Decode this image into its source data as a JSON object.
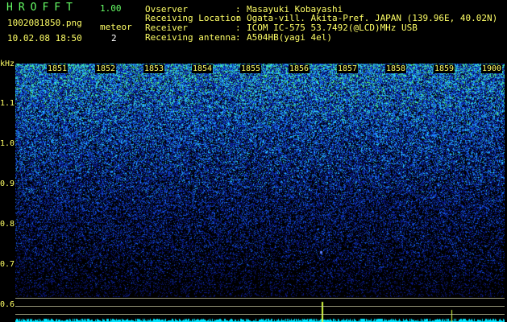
{
  "app": {
    "title": "HROFFT",
    "version": "1.00"
  },
  "file": {
    "name": "1002081850.png",
    "datetime": "10.02.08 18:50"
  },
  "meteor": {
    "label": "meteor",
    "count": "2"
  },
  "info": [
    {
      "key": "Ovserver",
      "value": "Masayuki Kobayashi"
    },
    {
      "key": "Receiving Location",
      "value": "Ogata-vill. Akita-Pref. JAPAN (139.96E, 40.02N)"
    },
    {
      "key": "Receiver",
      "value": "ICOM IC-575 53.7492(@LCD)MHz USB"
    },
    {
      "key": "Receiving antenna",
      "value": "A504HB(yagi 4el)"
    }
  ],
  "spectrogram": {
    "unit": "kHz",
    "x_ticks": [
      "1851",
      "1852",
      "1853",
      "1854",
      "1855",
      "1856",
      "1857",
      "1858",
      "1859",
      "1900"
    ],
    "y_ticks": [
      "1.1",
      "1.0",
      "0.9",
      "0.8",
      "0.7",
      "0.6"
    ],
    "colors": {
      "labels": "#ffff66",
      "noise_high": "#39d7ff",
      "noise_low": "#1020a0",
      "baseline": "#00e5ff"
    }
  }
}
